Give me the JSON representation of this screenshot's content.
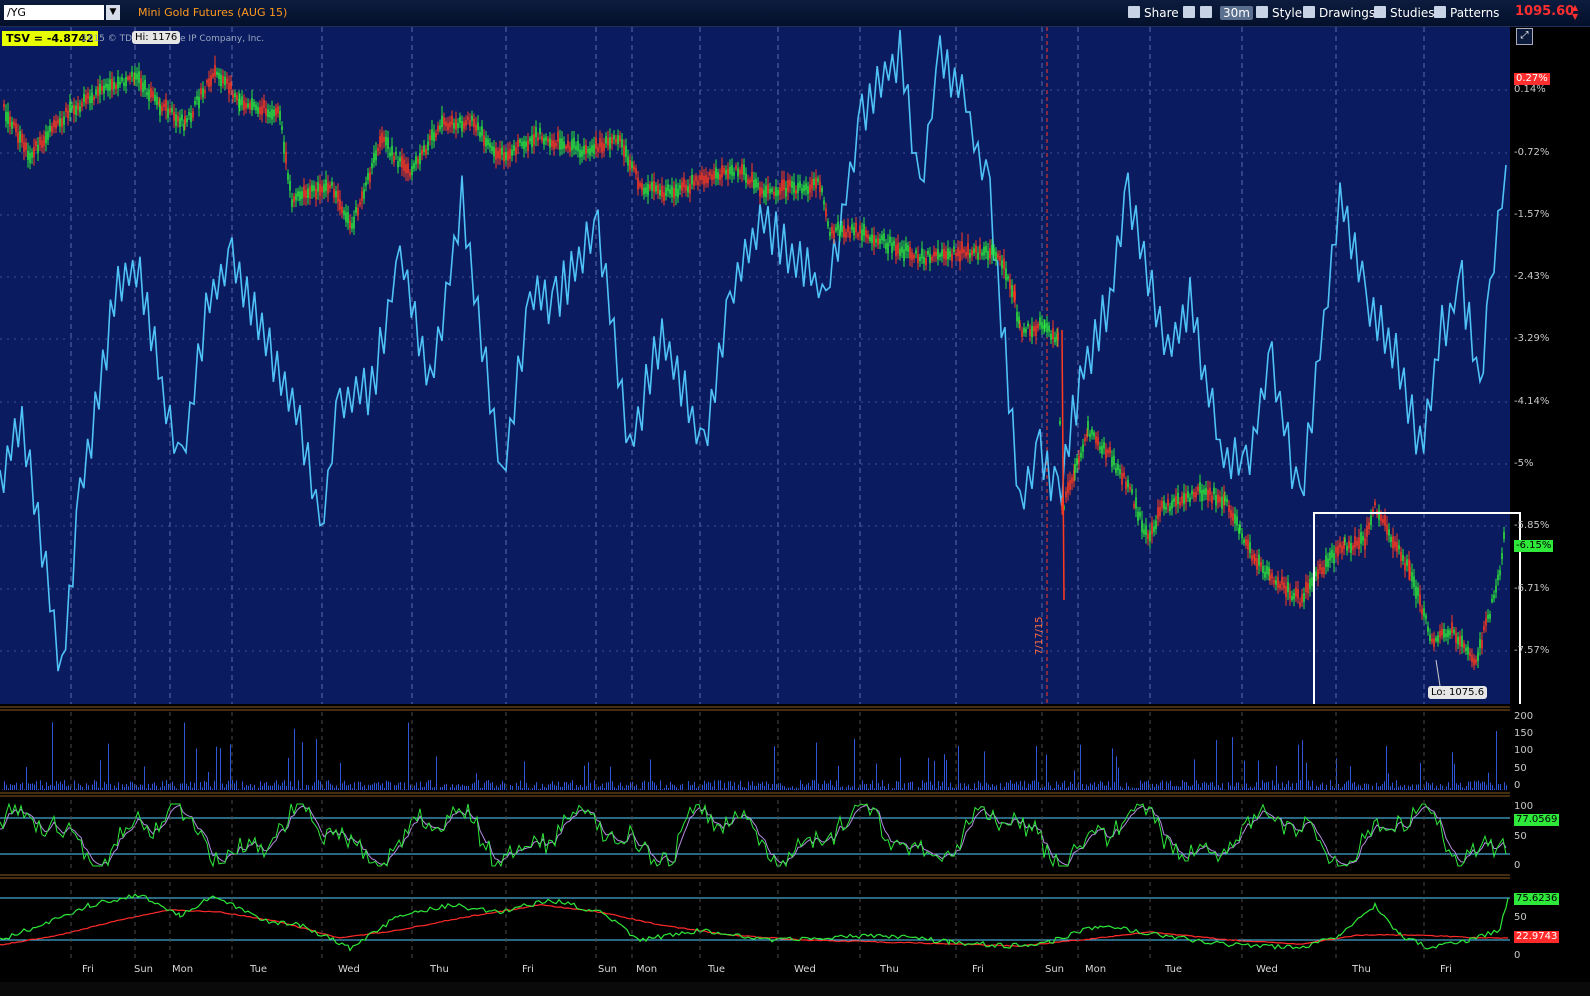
{
  "toolbar": {
    "symbol": "/YG",
    "title": "Mini Gold Futures (AUG 15)",
    "share": "Share",
    "timeframe": "30m",
    "style": "Style",
    "drawings": "Drawings",
    "studies": "Studies",
    "patterns": "Patterns",
    "last_price": "1095.60"
  },
  "overlay": {
    "tsv_label": "TSV  = -4.8742",
    "copyright": "2015 © TD Ameritrade IP Company, Inc.",
    "hi_label": "Hi: 1176",
    "lo_label": "Lo: 1075.6",
    "date_marker": "7/17/15"
  },
  "price_scale": {
    "top_badge": "0.27%",
    "current_badge": "-6.15%",
    "labels": [
      "0.14%",
      "-0.72%",
      "-1.57%",
      "-2.43%",
      "-3.29%",
      "-4.14%",
      "-5%",
      "-5.85%",
      "-6.71%",
      "-7.57%"
    ]
  },
  "volume_scale": [
    "200",
    "150",
    "100",
    "50",
    "0"
  ],
  "stoch_scale": {
    "labels": [
      "100",
      "50",
      "0"
    ],
    "badge": "77.0569"
  },
  "rsi_scale": {
    "labels": [
      "50",
      "0"
    ],
    "badge_green": "75.6236",
    "badge_red": "22.9743"
  },
  "days": [
    "Fri",
    "Sun",
    "Mon",
    "Tue",
    "Wed",
    "Thu",
    "Fri",
    "Sun",
    "Mon",
    "Tue",
    "Wed",
    "Thu",
    "Fri",
    "Sun",
    "Mon",
    "Tue",
    "Wed",
    "Thu",
    "Fri"
  ],
  "colors": {
    "chart_bg": "#0b1b5f",
    "tsv_line": "#4fc3f7",
    "up_candle": "#2ee83a",
    "down_candle": "#ff3b1f",
    "stoch_green": "#2ee83a",
    "stoch_purple": "#b48ce0",
    "level_line": "#52d0ff"
  }
}
